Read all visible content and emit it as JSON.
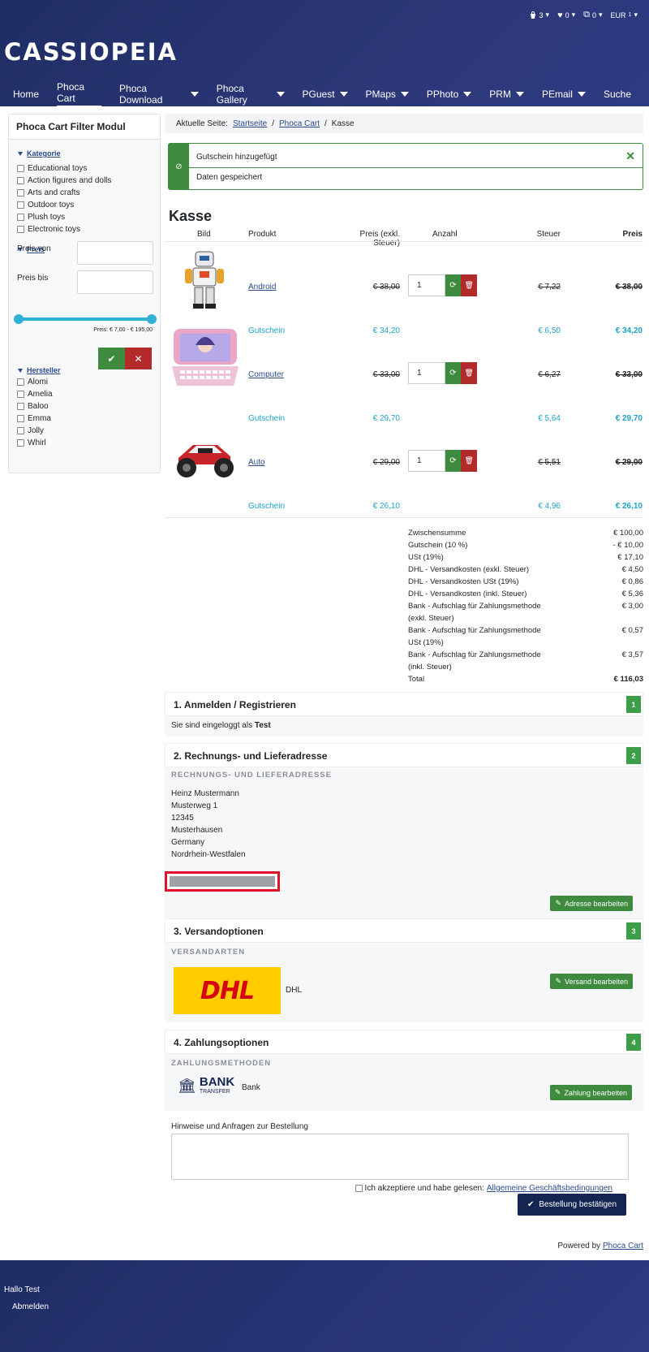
{
  "header": {
    "cart_count": "3",
    "wish_count": "0",
    "compare_count": "0",
    "currency": "EUR",
    "logo": "CASSIOPEIA",
    "nav": [
      {
        "label": "Home",
        "dropdown": false,
        "active": false
      },
      {
        "label": "Phoca Cart",
        "dropdown": false,
        "active": true
      },
      {
        "label": "Phoca Download",
        "dropdown": true,
        "active": false
      },
      {
        "label": "Phoca Gallery",
        "dropdown": true,
        "active": false
      },
      {
        "label": "PGuest",
        "dropdown": true,
        "active": false
      },
      {
        "label": "PMaps",
        "dropdown": true,
        "active": false
      },
      {
        "label": "PPhoto",
        "dropdown": true,
        "active": false
      },
      {
        "label": "PRM",
        "dropdown": true,
        "active": false
      },
      {
        "label": "PEmail",
        "dropdown": true,
        "active": false
      },
      {
        "label": "Suche",
        "dropdown": false,
        "active": false
      }
    ]
  },
  "sidebar": {
    "title": "Phoca Cart Filter Modul",
    "category_label": "Kategorie",
    "categories": [
      "Educational toys",
      "Action figures and dolls",
      "Arts and crafts",
      "Outdoor toys",
      "Plush toys",
      "Electronic toys"
    ],
    "price_label": "Preis",
    "price_from": "Preis von",
    "price_to": "Preis bis",
    "price_range": "Preis: € 7,00 - € 195,00",
    "manufacturer_label": "Hersteller",
    "manufacturers": [
      "Alomi",
      "Amelia",
      "Baloo",
      "Emma",
      "Jolly",
      "Whirl"
    ]
  },
  "breadcrumb": {
    "prefix": "Aktuelle Seite:",
    "items": [
      "Startseite",
      "Phoca Cart"
    ],
    "current": "Kasse"
  },
  "alert": {
    "line1": "Gutschein hinzugefügt",
    "line2": "Daten gespeichert",
    "close": "✕"
  },
  "checkout": {
    "title": "Kasse",
    "headers": {
      "image": "Bild",
      "product": "Produkt",
      "price": "Preis (exkl. Steuer)",
      "qty": "Anzahl",
      "tax": "Steuer",
      "total": "Preis"
    },
    "products": [
      {
        "name": "Android",
        "price": "€ 38,00",
        "qty": "1",
        "tax": "€ 7,22",
        "total": "€ 38,00",
        "coupon_label": "Gutschein",
        "coupon_price": "€ 34,20",
        "coupon_tax": "€ 6,50",
        "coupon_total": "€ 34,20"
      },
      {
        "name": "Computer",
        "price": "€ 33,00",
        "qty": "1",
        "tax": "€ 6,27",
        "total": "€ 33,00",
        "coupon_label": "Gutschein",
        "coupon_price": "€ 29,70",
        "coupon_tax": "€ 5,64",
        "coupon_total": "€ 29,70"
      },
      {
        "name": "Auto",
        "price": "€ 29,00",
        "qty": "1",
        "tax": "€ 5,51",
        "total": "€ 29,00",
        "coupon_label": "Gutschein",
        "coupon_price": "€ 26,10",
        "coupon_tax": "€ 4,96",
        "coupon_total": "€ 26,10"
      }
    ],
    "summary": [
      {
        "label": "Zwischensumme",
        "value": "€ 100,00"
      },
      {
        "label": "Gutschein (10 %)",
        "value": "- € 10,00"
      },
      {
        "label": "USt (19%)",
        "value": "€ 17,10"
      },
      {
        "label": "DHL - Versandkosten (exkl. Steuer)",
        "value": "€ 4,50"
      },
      {
        "label": "DHL - Versandkosten USt (19%)",
        "value": "€ 0,86"
      },
      {
        "label": "DHL - Versandkosten (inkl. Steuer)",
        "value": "€ 5,36"
      },
      {
        "label": "Bank - Aufschlag für Zahlungsmethode (exkl. Steuer)",
        "value": "€ 3,00"
      },
      {
        "label": "Bank - Aufschlag für Zahlungsmethode USt (19%)",
        "value": "€ 0,57"
      },
      {
        "label": "Bank - Aufschlag für Zahlungsmethode (inkl. Steuer)",
        "value": "€ 3,57"
      },
      {
        "label": "Total",
        "value": "€ 116,03"
      }
    ]
  },
  "step1": {
    "title": "1. Anmelden / Registrieren",
    "num": "1",
    "text": "Sie sind eingeloggt als",
    "user": "Test"
  },
  "step2": {
    "title": "2. Rechnungs- und Lieferadresse",
    "num": "2",
    "caption": "RECHNUNGS- UND LIEFERADRESSE",
    "address": [
      "Heinz Mustermann",
      "Musterweg 1",
      "12345",
      "Musterhausen",
      "Germany",
      "Nordrhein-Westfalen"
    ],
    "edit": "Adresse bearbeiten"
  },
  "step3": {
    "title": "3. Versandoptionen",
    "num": "3",
    "caption": "VERSANDARTEN",
    "method": "DHL",
    "logo_text": "DHL",
    "edit": "Versand bearbeiten"
  },
  "step4": {
    "title": "4. Zahlungsoptionen",
    "num": "4",
    "caption": "ZAHLUNGSMETHODEN",
    "method": "Bank",
    "logo_big": "BANK",
    "logo_small": "TRANSFER",
    "edit": "Zahlung bearbeiten"
  },
  "order": {
    "notes_label": "Hinweise und Anfragen zur Bestellung",
    "terms_prefix": "Ich akzeptiere und habe gelesen:",
    "terms_link": "Allgemeine Geschäftsbedingungen",
    "confirm": "Bestellung bestätigen",
    "powered": "Powered by",
    "powered_link": "Phoca Cart"
  },
  "footer": {
    "greeting": "Hallo Test",
    "logout": "Abmelden"
  }
}
